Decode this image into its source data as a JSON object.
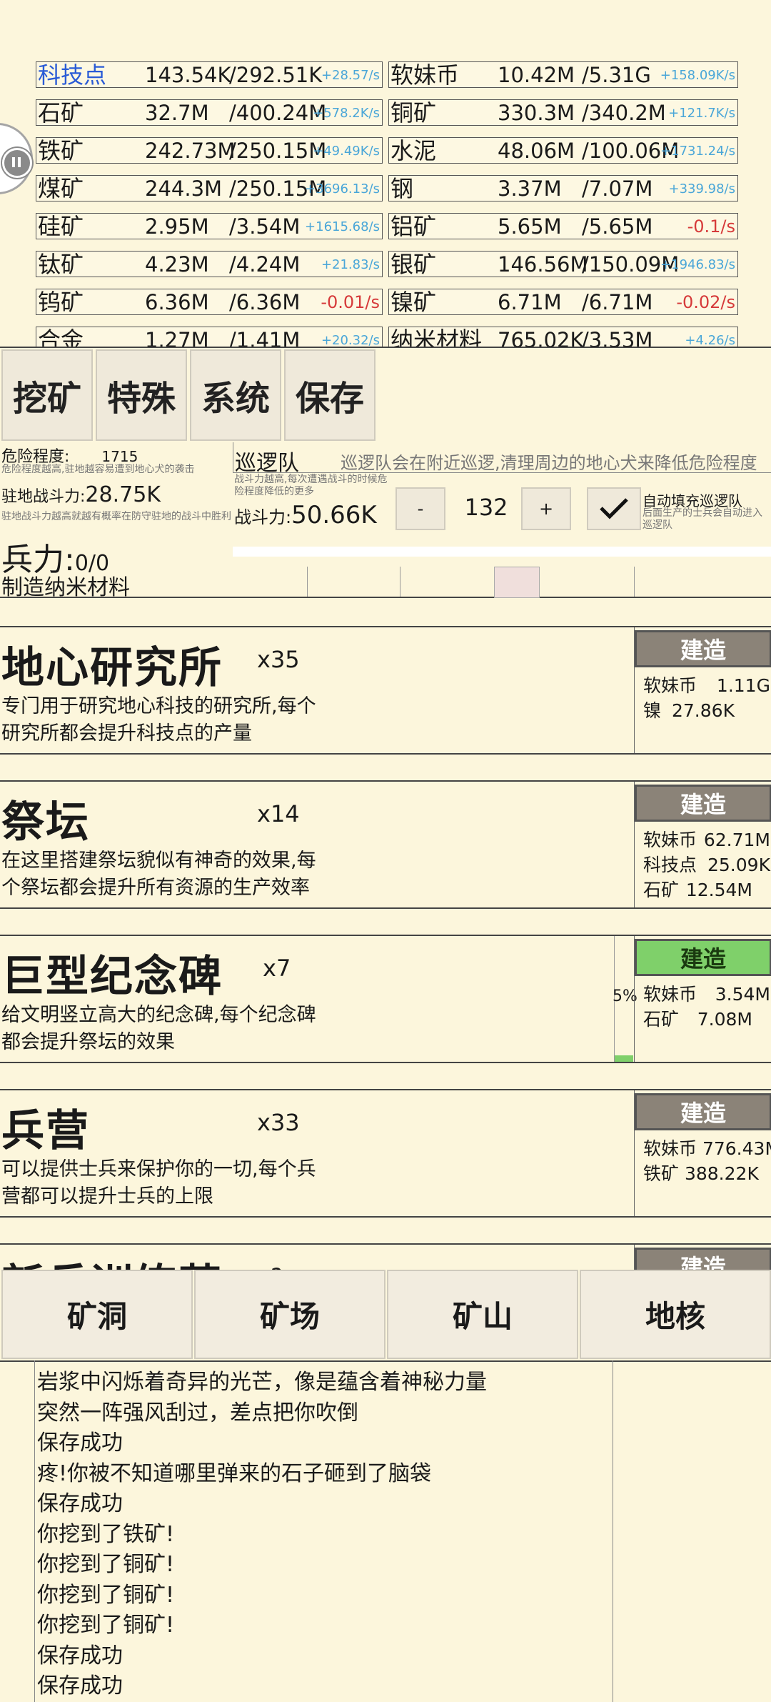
{
  "resources_left": [
    {
      "name": "科技点",
      "value": "143.54K",
      "max": "/292.51K",
      "rate": "+28.57/s",
      "sign": "pos",
      "link": true
    },
    {
      "name": "石矿",
      "value": "32.7M",
      "max": "/400.24M",
      "rate": "+578.2K/s",
      "sign": "pos"
    },
    {
      "name": "铁矿",
      "value": "242.73M",
      "max": "/250.15M",
      "rate": "+49.49K/s",
      "sign": "pos"
    },
    {
      "name": "煤矿",
      "value": "244.3M",
      "max": "/250.15M",
      "rate": "+3696.13/s",
      "sign": "pos"
    },
    {
      "name": "硅矿",
      "value": "2.95M",
      "max": "/3.54M",
      "rate": "+1615.68/s",
      "sign": "pos"
    },
    {
      "name": "钛矿",
      "value": "4.23M",
      "max": "/4.24M",
      "rate": "+21.83/s",
      "sign": "pos"
    },
    {
      "name": "钨矿",
      "value": "6.36M",
      "max": "/6.36M",
      "rate": "-0.01/s",
      "sign": "neg"
    },
    {
      "name": "合金",
      "value": "1.27M",
      "max": "/1.41M",
      "rate": "+20.32/s",
      "sign": "pos"
    }
  ],
  "resources_right": [
    {
      "name": "软妹币",
      "value": "10.42M",
      "max": "/5.31G",
      "rate": "+158.09K/s",
      "sign": "pos"
    },
    {
      "name": "铜矿",
      "value": "330.3M",
      "max": "/340.2M",
      "rate": "+121.7K/s",
      "sign": "pos"
    },
    {
      "name": "水泥",
      "value": "48.06M",
      "max": "/100.06M",
      "rate": "+1731.24/s",
      "sign": "pos"
    },
    {
      "name": "钢",
      "value": "3.37M",
      "max": "/7.07M",
      "rate": "+339.98/s",
      "sign": "pos"
    },
    {
      "name": "铝矿",
      "value": "5.65M",
      "max": "/5.65M",
      "rate": "-0.1/s",
      "sign": "neg"
    },
    {
      "name": "银矿",
      "value": "146.56M",
      "max": "/150.09M",
      "rate": "+1946.83/s",
      "sign": "pos"
    },
    {
      "name": "镍矿",
      "value": "6.71M",
      "max": "/6.71M",
      "rate": "-0.02/s",
      "sign": "neg"
    },
    {
      "name": "纳米材料",
      "value": "765.02K",
      "max": "/3.53M",
      "rate": "+4.26/s",
      "sign": "pos"
    }
  ],
  "top_menu": {
    "mining": "挖矿",
    "special": "特殊",
    "system": "系统",
    "save": "保存"
  },
  "danger": {
    "label": "危险程度:",
    "value": "1715",
    "desc": "危险程度越高,驻地越容易遭到地心犬的袭击",
    "garrison_label": "驻地战斗力:",
    "garrison_value": "28.75K",
    "garrison_desc": "驻地战斗力越高就越有概率在防守驻地的战斗中胜利",
    "troops_label": "兵力:",
    "troops_value": "0/0"
  },
  "patrol": {
    "title": "巡逻队",
    "title_desc": "巡逻队会在附近巡逻,清理周边的地心犬来降低危险程度",
    "power_desc": "战斗力越高,每次遭遇战斗的时候危险程度降低的更多",
    "power_label": "战斗力:",
    "power_value": "50.66K",
    "minus": "-",
    "count": "132",
    "plus": "+",
    "auto_label": "自动填充巡逻队",
    "auto_desc": "后面生产的士兵会自动进入巡逻队"
  },
  "craft_row": {
    "label": "制造纳米材料"
  },
  "buildings": [
    {
      "name": "地心研究所",
      "count": "x35",
      "desc": "专门用于研究地心科技的研究所,每个研究所都会提升科技点的产量",
      "button": "建造",
      "costs": [
        {
          "n": "软妹币",
          "v": "1.11G"
        },
        {
          "n": "镍",
          "v": "27.86K"
        }
      ]
    },
    {
      "name": "祭坛",
      "count": "x14",
      "desc": "在这里搭建祭坛貌似有神奇的效果,每个祭坛都会提升所有资源的生产效率",
      "button": "建造",
      "costs": [
        {
          "n": "软妹币",
          "v": "62.71M"
        },
        {
          "n": "科技点",
          "v": "25.09K"
        },
        {
          "n": "石矿",
          "v": "12.54M"
        }
      ]
    },
    {
      "name": "巨型纪念碑",
      "count": "x7",
      "desc": "给文明竖立高大的纪念碑,每个纪念碑都会提升祭坛的效果",
      "button": "建造",
      "progress": "5%",
      "progress_value": 0.05,
      "costs": [
        {
          "n": "软妹币",
          "v": "3.54M"
        },
        {
          "n": "石矿",
          "v": "7.08M"
        }
      ]
    },
    {
      "name": "兵营",
      "count": "x33",
      "desc": "可以提供士兵来保护你的一切,每个兵营都可以提升士兵的上限",
      "button": "建造",
      "costs": [
        {
          "n": "软妹币",
          "v": "776.43M"
        },
        {
          "n": "铁矿",
          "v": "388.22K"
        }
      ]
    },
    {
      "name": "新兵训练营",
      "count": "x?",
      "desc": "",
      "button": "建造",
      "costs": []
    }
  ],
  "bottom_tabs": {
    "cave": "矿洞",
    "field": "矿场",
    "mountain": "矿山",
    "core": "地核"
  },
  "log": [
    "岩浆中闪烁着奇异的光芒，像是蕴含着神秘力量",
    "突然一阵强风刮过，差点把你吹倒",
    "保存成功",
    "疼!你被不知道哪里弹来的石子砸到了脑袋",
    "保存成功",
    "你挖到了铁矿!",
    "你挖到了铜矿!",
    "你挖到了铜矿!",
    "你挖到了铜矿!",
    "保存成功",
    "保存成功"
  ]
}
